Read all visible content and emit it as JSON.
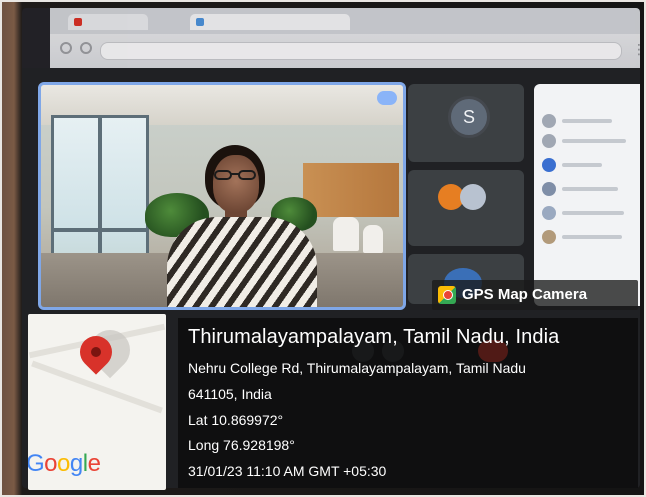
{
  "overlay": {
    "badge_label": "GPS Map Camera",
    "location_title": "Thirumalayampalayam, Tamil Nadu, India",
    "address_line1": "Nehru College Rd, Thirumalayampalayam, Tamil Nadu",
    "address_line2": "641105, India",
    "latitude": "Lat 10.869972°",
    "longitude": "Long 76.928198°",
    "datetime": "31/01/23 11:10 AM GMT +05:30"
  },
  "map": {
    "logo_letters": [
      "G",
      "o",
      "o",
      "g",
      "l",
      "e"
    ],
    "logo_colors": [
      "#4285F4",
      "#EA4335",
      "#FBBC05",
      "#4285F4",
      "#34A853",
      "#EA4335"
    ]
  },
  "meeting": {
    "participant_s_initial": "S",
    "main_tile_border": "#7fa7e8",
    "end_call_color": "#ea4335"
  },
  "icons": [
    "gps-camera-icon",
    "map-pin-icon",
    "mic-indicator-icon",
    "avatar",
    "end-call-icon",
    "kebab-menu-icon"
  ]
}
